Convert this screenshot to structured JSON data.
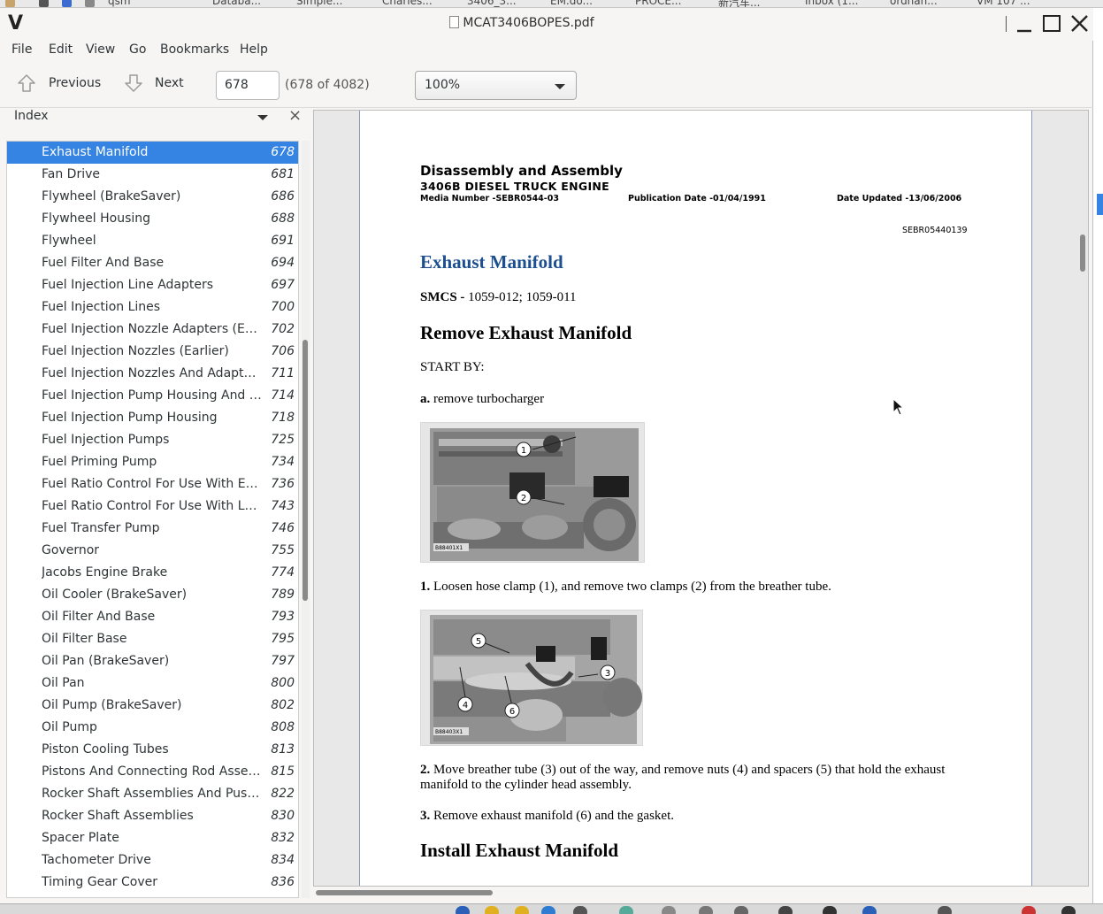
{
  "taskbar_top": {
    "items": [
      "qsm",
      "Databa...",
      "Simple...",
      "Charles...",
      "3406_3...",
      "EM.do...",
      "PROCE...",
      "新汽车...",
      "Inbox (1...",
      "ordnan...",
      "VM 107 ..."
    ]
  },
  "window": {
    "app_logo": "V",
    "title": "MCAT3406BOPES.pdf"
  },
  "menu": [
    "File",
    "Edit",
    "View",
    "Go",
    "Bookmarks",
    "Help"
  ],
  "toolbar": {
    "previous_label": "Previous",
    "next_label": "Next",
    "page_value": "678",
    "page_count": "(678 of 4082)",
    "zoom_value": "100%"
  },
  "sidebar": {
    "header": "Index",
    "items": [
      {
        "title": "Exhaust Manifold",
        "page": "678"
      },
      {
        "title": "Fan Drive",
        "page": "681"
      },
      {
        "title": "Flywheel (BrakeSaver)",
        "page": "686"
      },
      {
        "title": "Flywheel Housing",
        "page": "688"
      },
      {
        "title": "Flywheel",
        "page": "691"
      },
      {
        "title": "Fuel Filter And Base",
        "page": "694"
      },
      {
        "title": "Fuel Injection Line Adapters",
        "page": "697"
      },
      {
        "title": "Fuel Injection Lines",
        "page": "700"
      },
      {
        "title": "Fuel Injection Nozzle Adapters (Earl...",
        "page": "702"
      },
      {
        "title": "Fuel Injection Nozzles (Earlier)",
        "page": "706"
      },
      {
        "title": "Fuel Injection Nozzles And Adapters...",
        "page": "711"
      },
      {
        "title": "Fuel Injection Pump Housing And G...",
        "page": "714"
      },
      {
        "title": "Fuel Injection Pump Housing",
        "page": "718"
      },
      {
        "title": "Fuel Injection Pumps",
        "page": "725"
      },
      {
        "title": "Fuel Priming Pump",
        "page": "734"
      },
      {
        "title": "Fuel Ratio Control For Use With Ear...",
        "page": "736"
      },
      {
        "title": "Fuel Ratio Control For Use With Lat...",
        "page": "743"
      },
      {
        "title": "Fuel Transfer Pump",
        "page": "746"
      },
      {
        "title": "Governor",
        "page": "755"
      },
      {
        "title": "Jacobs Engine Brake",
        "page": "774"
      },
      {
        "title": "Oil Cooler (BrakeSaver)",
        "page": "789"
      },
      {
        "title": "Oil Filter And Base",
        "page": "793"
      },
      {
        "title": "Oil Filter Base",
        "page": "795"
      },
      {
        "title": "Oil Pan (BrakeSaver)",
        "page": "797"
      },
      {
        "title": "Oil Pan",
        "page": "800"
      },
      {
        "title": "Oil Pump (BrakeSaver)",
        "page": "802"
      },
      {
        "title": "Oil Pump",
        "page": "808"
      },
      {
        "title": "Piston Cooling Tubes",
        "page": "813"
      },
      {
        "title": "Pistons And Connecting Rod Assem...",
        "page": "815"
      },
      {
        "title": "Rocker Shaft Assemblies And Push ...",
        "page": "822"
      },
      {
        "title": "Rocker Shaft Assemblies",
        "page": "830"
      },
      {
        "title": "Spacer Plate",
        "page": "832"
      },
      {
        "title": "Tachometer Drive",
        "page": "834"
      },
      {
        "title": "Timing Gear Cover",
        "page": "836"
      }
    ]
  },
  "document": {
    "heading": "Disassembly and Assembly",
    "subheading": "3406B DIESEL TRUCK ENGINE",
    "media_number": "Media Number -SEBR0544-03",
    "publication_date": "Publication Date -01/04/1991",
    "date_updated": "Date Updated -13/06/2006",
    "reference": "SEBR05440139",
    "section_title": "Exhaust Manifold",
    "smcs_label": "SMCS -",
    "smcs_value": " 1059-012; 1059-011",
    "remove_title": "Remove Exhaust Manifold",
    "start_by": "START BY:",
    "prereq_label": "a.",
    "prereq_text": " remove turbocharger",
    "photo1_caption": "B88401X1",
    "photo1_callouts": [
      "1",
      "2"
    ],
    "step1_label": "1.",
    "step1_text": " Loosen hose clamp (1), and remove two clamps (2) from the breather tube.",
    "photo2_caption": "B88403X1",
    "photo2_callouts": [
      "5",
      "3",
      "4",
      "6"
    ],
    "step2_label": "2.",
    "step2_text": " Move breather tube (3) out of the way, and remove nuts (4) and spacers (5) that hold the exhaust manifold to the cylinder head assembly.",
    "step3_label": "3.",
    "step3_text": " Remove exhaust manifold (6) and the gasket.",
    "install_title": "Install Exhaust Manifold"
  },
  "colors": {
    "selection": "#3584e4",
    "section_title": "#1c4f8f",
    "window_bg": "#f6f5f4"
  }
}
